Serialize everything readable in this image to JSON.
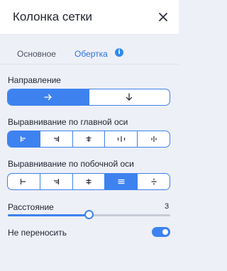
{
  "header": {
    "title": "Колонка сетки",
    "close_icon": "close-icon"
  },
  "tabs": [
    {
      "label": "Основное",
      "active": false
    },
    {
      "label": "Обертка",
      "active": true,
      "badge": "i"
    }
  ],
  "direction": {
    "label": "Направление",
    "options": [
      {
        "icon": "arrow-right-icon",
        "selected": true
      },
      {
        "icon": "arrow-down-icon",
        "selected": false
      }
    ]
  },
  "main_axis": {
    "label": "Выравнивание по главной оси",
    "options": [
      {
        "icon": "justify-start-icon",
        "selected": true
      },
      {
        "icon": "justify-end-icon",
        "selected": false
      },
      {
        "icon": "justify-center-icon",
        "selected": false
      },
      {
        "icon": "justify-space-between-icon",
        "selected": false
      },
      {
        "icon": "justify-space-around-icon",
        "selected": false
      }
    ]
  },
  "cross_axis": {
    "label": "Выравнивание по побочной оси",
    "options": [
      {
        "icon": "align-start-icon",
        "selected": false
      },
      {
        "icon": "align-end-icon",
        "selected": false
      },
      {
        "icon": "align-center-icon",
        "selected": false
      },
      {
        "icon": "align-stretch-icon",
        "selected": true
      },
      {
        "icon": "align-baseline-icon",
        "selected": false
      }
    ]
  },
  "spacing": {
    "label": "Расстояние",
    "value": "3",
    "fraction": 0.5
  },
  "nowrap": {
    "label": "Не переносить",
    "enabled": true
  },
  "colors": {
    "accent": "#3d82ef",
    "tab_active": "#2f72e8",
    "background": "#eef0f7"
  }
}
